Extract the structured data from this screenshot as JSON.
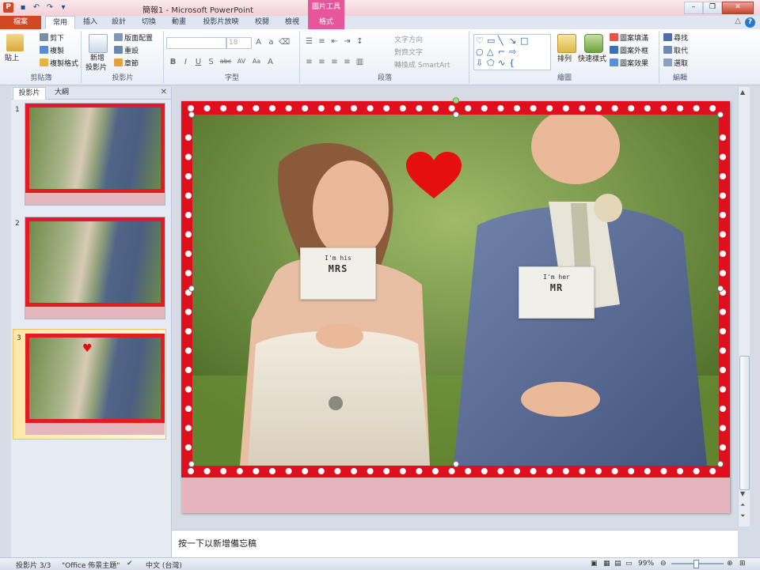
{
  "title_bar": {
    "app_letter": "P",
    "window_title": "簡報1 - Microsoft PowerPoint",
    "context_tab_group": "圖片工具",
    "controls": [
      "minimize-icon",
      "restore-icon",
      "close-icon"
    ]
  },
  "tabs": [
    {
      "label": "檔案"
    },
    {
      "label": "常用"
    },
    {
      "label": "插入"
    },
    {
      "label": "設計"
    },
    {
      "label": "切換"
    },
    {
      "label": "動畫"
    },
    {
      "label": "投影片放映"
    },
    {
      "label": "校閱"
    },
    {
      "label": "檢視"
    },
    {
      "label": "格式"
    }
  ],
  "active_tab": "常用",
  "ribbon": {
    "clipboard": {
      "paste": "貼上",
      "cut": "剪下",
      "copy": "複製",
      "format_painter": "複製格式",
      "label": "剪貼簿"
    },
    "slides": {
      "new_slide": "新增",
      "new_slide2": "投影片",
      "layout": "版面配置",
      "reset": "重設",
      "section": "章節",
      "label": "投影片"
    },
    "font": {
      "font_name": "",
      "font_size": "18",
      "label": "字型",
      "buttons": [
        "B",
        "I",
        "U",
        "S",
        "abc",
        "AV",
        "Aa",
        "A"
      ]
    },
    "paragraph": {
      "text_direction": "文字方向",
      "align_text": "對齊文字",
      "smartart": "轉換成 SmartArt",
      "label": "段落"
    },
    "drawing": {
      "arrange": "排列",
      "quick_styles": "快速樣式",
      "shape_fill": "圖案填滿",
      "shape_outline": "圖案外框",
      "shape_effects": "圖案效果",
      "label": "繪圖"
    },
    "editing": {
      "find": "尋找",
      "replace": "取代",
      "select": "選取",
      "label": "編輯"
    }
  },
  "left_pane": {
    "tabs": [
      "投影片",
      "大綱"
    ],
    "slides": [
      {
        "number": "1"
      },
      {
        "number": "2"
      },
      {
        "number": "3"
      }
    ],
    "selected": 3
  },
  "slide": {
    "sign_bride_line1": "I'm his",
    "sign_bride_line2": "MRS",
    "sign_groom_line1": "I'm her",
    "sign_groom_line2": "MR"
  },
  "notes": {
    "placeholder": "按一下以新增備忘稿"
  },
  "status": {
    "slide_info": "投影片 3/3",
    "theme": "\"Office 佈景主題\"",
    "language": "中文 (台灣)",
    "zoom": "99%"
  },
  "colors": {
    "accent": "#d24726",
    "frame_red": "#e00f1e",
    "slide_bottom": "#e6b5bb",
    "context_pink": "#e7569a"
  }
}
